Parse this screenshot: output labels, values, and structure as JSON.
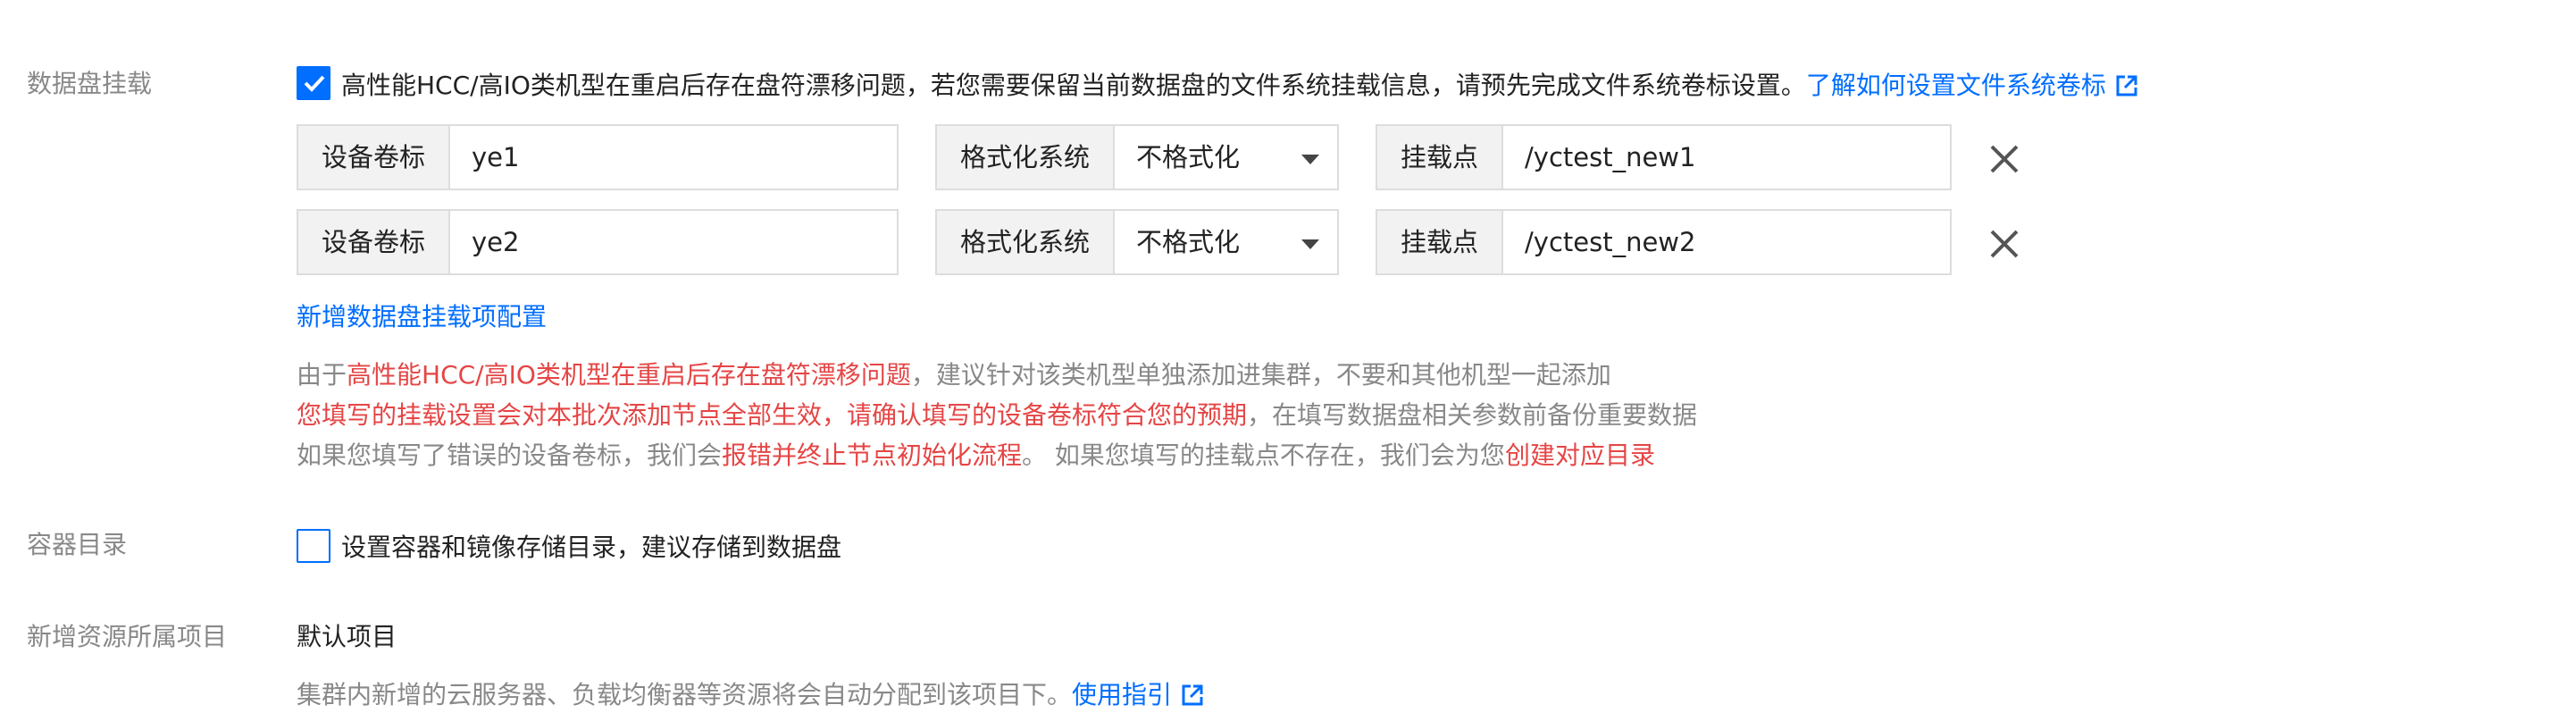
{
  "data_disk": {
    "label": "数据盘挂载",
    "notice_text": "高性能HCC/高IO类机型在重启后存在盘符漂移问题，若您需要保留当前数据盘的文件系统挂载信息，请预先完成文件系统卷标设置。",
    "notice_link": "了解如何设置文件系统卷标",
    "notice_checked": true,
    "entries": [
      {
        "volume_label": "设备卷标",
        "volume_value": "ye1",
        "fs_label": "格式化系统",
        "fs_value": "不格式化",
        "mount_label": "挂载点",
        "mount_value": "/yctest_new1"
      },
      {
        "volume_label": "设备卷标",
        "volume_value": "ye2",
        "fs_label": "格式化系统",
        "fs_value": "不格式化",
        "mount_label": "挂载点",
        "mount_value": "/yctest_new2"
      }
    ],
    "add_link": "新增数据盘挂载项配置",
    "tips": {
      "line1_a": "由于",
      "line1_b": "高性能HCC/高IO类机型在重启后存在盘符漂移问题",
      "line1_c": "，建议针对该类机型单独添加进集群，不要和其他机型一起添加",
      "line2_a": "您填写的挂载设置会对本批次添加节点全部生效，请确认填写的设备卷标符合您的预期",
      "line2_b": "，在填写数据盘相关参数前备份重要数据",
      "line3_a": "如果您填写了错误的设备卷标，我们会",
      "line3_b": "报错并终止节点初始化流程",
      "line3_c": "。 如果您填写的挂载点不存在，我们会为您",
      "line3_d": "创建对应目录"
    }
  },
  "container_dir": {
    "label": "容器目录",
    "checkbox_text": "设置容器和镜像存储目录，建议存储到数据盘",
    "checked": false
  },
  "project": {
    "label": "新增资源所属项目",
    "value": "默认项目",
    "hint": "集群内新增的云服务器、负载均衡器等资源将会自动分配到该项目下。",
    "hint_link": "使用指引"
  },
  "colors": {
    "accent": "#006eff",
    "warning": "#e54545",
    "muted": "#888888"
  },
  "icons": [
    "checkmark-icon",
    "external-link-icon",
    "caret-down-icon",
    "close-icon"
  ]
}
